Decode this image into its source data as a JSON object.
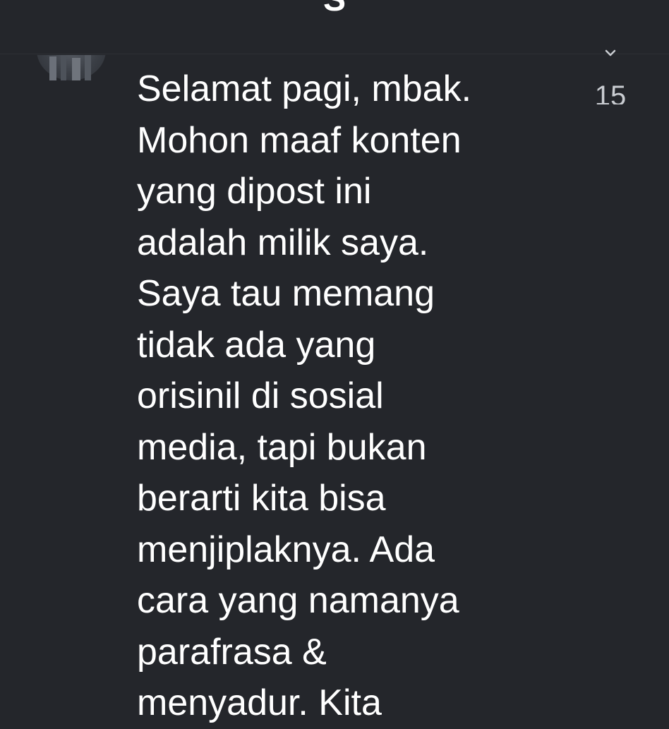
{
  "header": {
    "title": "S"
  },
  "comment": {
    "text": "Selamat pagi, mbak.\nMohon maaf konten\nyang dipost ini\nadalah milik saya.\nSaya tau memang\ntidak ada yang\norisinil di sosial\nmedia, tapi bukan\nberarti kita bisa\nmenjiplaknya. Ada\ncara yang namanya\nparafrasa &\nmenyadur. Kita",
    "like_count": "15"
  },
  "icons": {
    "avatar": "avatar",
    "like": "chevron-down-icon"
  },
  "colors": {
    "background": "#24262b",
    "text": "#ffffff",
    "secondary_text": "#c9ccd1"
  }
}
